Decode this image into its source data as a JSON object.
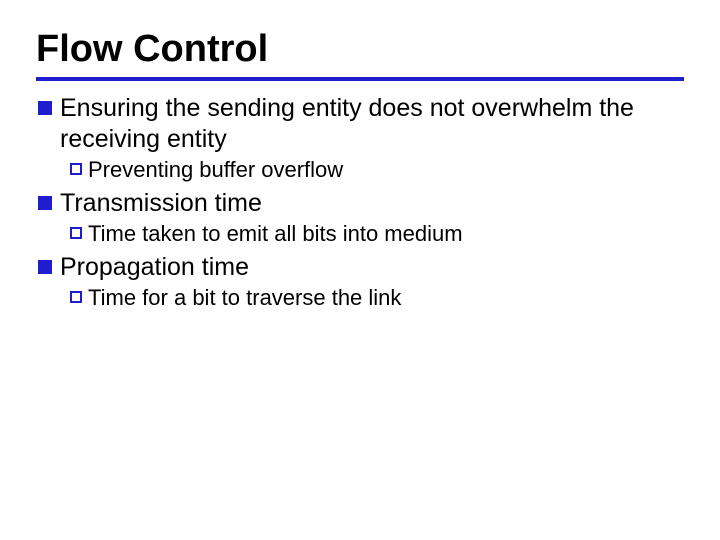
{
  "title": "Flow Control",
  "items": [
    {
      "text": "Ensuring the sending entity does not overwhelm the receiving entity",
      "sub": [
        {
          "text": "Preventing buffer overflow"
        }
      ]
    },
    {
      "text": "Transmission time",
      "sub": [
        {
          "text": "Time taken to emit all bits into medium"
        }
      ]
    },
    {
      "text": "Propagation time",
      "sub": [
        {
          "text": "Time for a bit to traverse the link"
        }
      ]
    }
  ]
}
